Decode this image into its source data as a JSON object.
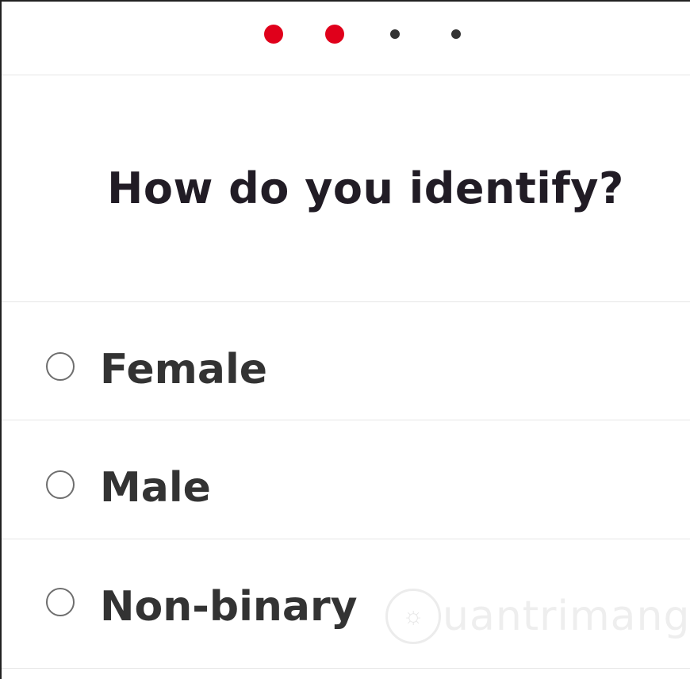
{
  "progress": {
    "steps_total": 4,
    "steps_completed": 2,
    "active_color": "#e0001b",
    "inactive_color": "#333333"
  },
  "question": {
    "title": "How do you identify?"
  },
  "options": [
    {
      "label": "Female",
      "selected": false
    },
    {
      "label": "Male",
      "selected": false
    },
    {
      "label": "Non-binary",
      "selected": false
    }
  ],
  "watermark": {
    "text": "uantrimang",
    "icon": "lightbulb-icon"
  }
}
